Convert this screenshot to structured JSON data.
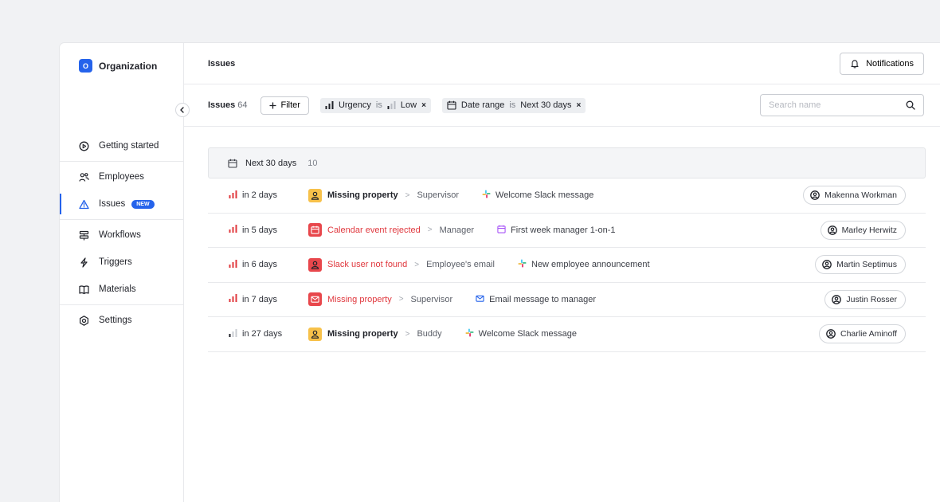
{
  "sidebar": {
    "org_initial": "O",
    "org_name": "Organization",
    "items": [
      {
        "label": "Getting started",
        "icon": "play-circle-icon"
      },
      {
        "label": "Employees",
        "icon": "users-icon"
      },
      {
        "label": "Issues",
        "icon": "warning-triangle-icon",
        "badge": "NEW",
        "active": true
      },
      {
        "label": "Workflows",
        "icon": "workflow-icon"
      },
      {
        "label": "Triggers",
        "icon": "lightning-icon"
      },
      {
        "label": "Materials",
        "icon": "book-icon"
      },
      {
        "label": "Settings",
        "icon": "gear-icon"
      }
    ]
  },
  "header": {
    "title": "Issues",
    "notifications_label": "Notifications"
  },
  "filters": {
    "issues_label": "Issues",
    "issues_count": "64",
    "filter_label": "Filter",
    "urgency": {
      "field": "Urgency",
      "op": "is",
      "value": "Low"
    },
    "date_range": {
      "field": "Date range",
      "op": "is",
      "value": "Next 30 days"
    },
    "x": "×"
  },
  "search": {
    "placeholder": "Search name"
  },
  "group": {
    "label": "Next 30 days",
    "count": "10"
  },
  "rows": [
    {
      "due": "in 2 days",
      "urgency": "high",
      "issue_icon": "person-icon",
      "issue_color": "#f7c14a",
      "title": "Missing property",
      "title_red": false,
      "sep": ">",
      "sub": "Supervisor",
      "workflow_icon": "slack-icon",
      "workflow": "Welcome Slack message",
      "assignee": "Makenna Workman"
    },
    {
      "due": "in 5 days",
      "urgency": "high",
      "issue_icon": "calendar-icon",
      "issue_color": "#e8474c",
      "title": "Calendar event rejected",
      "title_red": true,
      "sep": ">",
      "sub": "Manager",
      "workflow_icon": "calendar-icon",
      "workflow": "First week manager 1-on-1",
      "assignee": "Marley Herwitz"
    },
    {
      "due": "in 6 days",
      "urgency": "high",
      "issue_icon": "person-icon",
      "issue_color": "#e8474c",
      "title": "Slack user not found",
      "title_red": true,
      "sep": ">",
      "sub": "Employee's email",
      "workflow_icon": "slack-icon",
      "workflow": "New employee announcement",
      "assignee": "Martin Septimus"
    },
    {
      "due": "in 7 days",
      "urgency": "high",
      "issue_icon": "mail-icon",
      "issue_color": "#e8474c",
      "title": "Missing property",
      "title_red": true,
      "sep": ">",
      "sub": "Supervisor",
      "workflow_icon": "mail-icon",
      "workflow": "Email message to manager",
      "assignee": "Justin Rosser"
    },
    {
      "due": "in 27 days",
      "urgency": "low",
      "issue_icon": "person-icon",
      "issue_color": "#f7c14a",
      "title": "Missing property",
      "title_red": false,
      "sep": ">",
      "sub": "Buddy",
      "workflow_icon": "slack-icon",
      "workflow": "Welcome Slack message",
      "assignee": "Charlie Aminoff"
    }
  ]
}
